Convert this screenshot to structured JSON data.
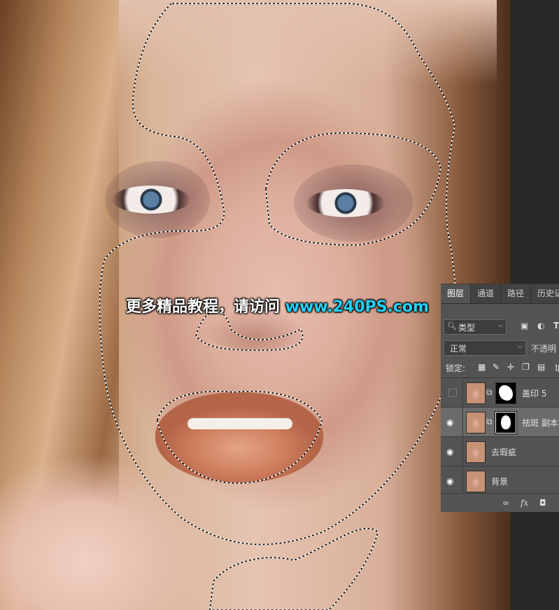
{
  "watermark": {
    "prefix": "更多精品教程，请访问 ",
    "url": "www.240PS.com"
  },
  "layers_panel": {
    "tabs": [
      {
        "label": "图层",
        "active": true
      },
      {
        "label": "通道",
        "active": false
      },
      {
        "label": "路径",
        "active": false
      },
      {
        "label": "历史记",
        "active": false
      }
    ],
    "filter": {
      "label": "类型",
      "icon": "search-icon"
    },
    "filter_icons": [
      "image-icon",
      "adjustment-icon",
      "type-icon"
    ],
    "blend_mode": "正常",
    "opacity_label": "不透明",
    "lock_label": "锁定:",
    "lock_icons": [
      "transparency-lock-icon",
      "brush-lock-icon",
      "move-lock-icon",
      "artboard-lock-icon",
      "padlock-icon"
    ],
    "fill_label": "填",
    "layers": [
      {
        "name": "盖印 5",
        "visible": false,
        "has_mask": true,
        "selected": false
      },
      {
        "name": "祛斑 副本",
        "visible": true,
        "has_mask": true,
        "selected": true
      },
      {
        "name": "去瑕疵",
        "visible": true,
        "has_mask": false,
        "selected": false
      },
      {
        "name": "背景",
        "visible": true,
        "has_mask": false,
        "selected": false
      }
    ],
    "bottom_icons": [
      "link-icon",
      "fx-icon",
      "mask-icon"
    ],
    "fx_label": "fx"
  },
  "colors": {
    "panel_bg": "#535353",
    "tab_bar": "#424242",
    "selected_row": "#6b6b6b",
    "watermark_url": "#1fd4ff"
  }
}
